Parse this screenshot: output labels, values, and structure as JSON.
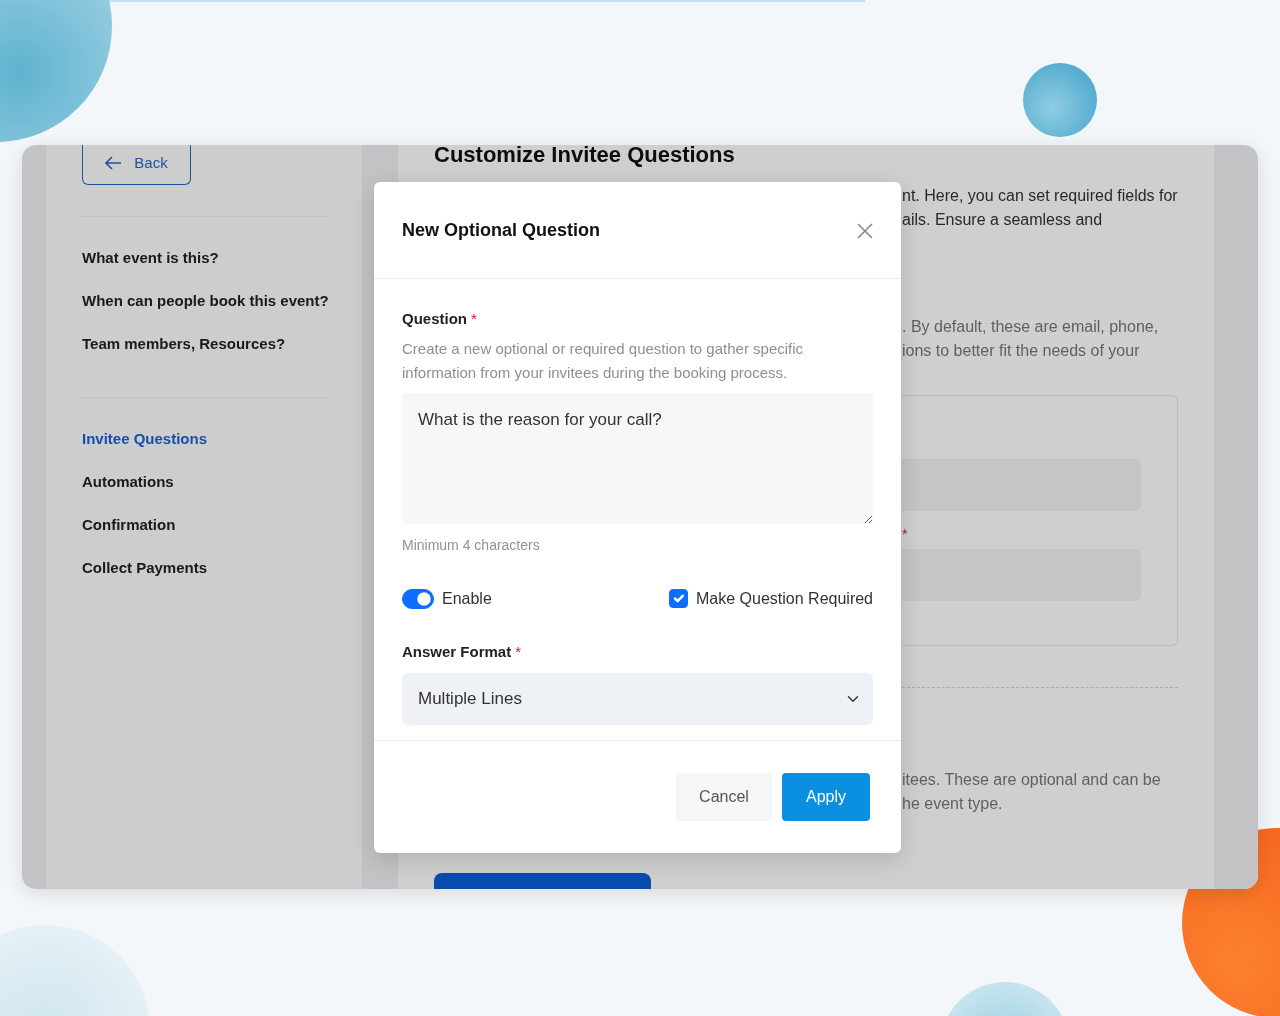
{
  "sidebar": {
    "back_button": "Back",
    "groups": [
      {
        "items": [
          {
            "label": "What event is this?",
            "selected": false
          },
          {
            "label": "When can people book this event?",
            "selected": false
          },
          {
            "label": "Team members, Resources?",
            "selected": false
          }
        ]
      },
      {
        "items": [
          {
            "label": "Invitee Questions",
            "selected": true
          },
          {
            "label": "Automations",
            "selected": false
          },
          {
            "label": "Confirmation",
            "selected": false
          },
          {
            "label": "Collect Payments",
            "selected": false
          }
        ]
      }
    ]
  },
  "main": {
    "title": "Customize Invitee Questions",
    "intro_lines": [
      "nt. Here, you can set required fields for",
      "ails. Ensure a seamless and"
    ],
    "default_lines": [
      ". By default, these are email, phone,",
      "ions to better fit the needs of your"
    ],
    "field_required_mark": "*",
    "optional_lines": [
      "itees. These are optional and can be",
      "he event type."
    ]
  },
  "modal": {
    "title": "New Optional Question",
    "question_label": "Question",
    "question_required_mark": "*",
    "help": "Create a new optional or required question to gather specific information from your invitees during the booking process.",
    "question_value": "What is the reason for your call?",
    "hint": "Minimum 4 characters",
    "enable": {
      "label": "Enable",
      "on": true
    },
    "required_checkbox": {
      "label": "Make Question Required",
      "checked": true
    },
    "answer_format": {
      "label": "Answer Format",
      "required_mark": "*",
      "value": "Multiple Lines"
    },
    "buttons": {
      "cancel": "Cancel",
      "apply": "Apply"
    }
  }
}
